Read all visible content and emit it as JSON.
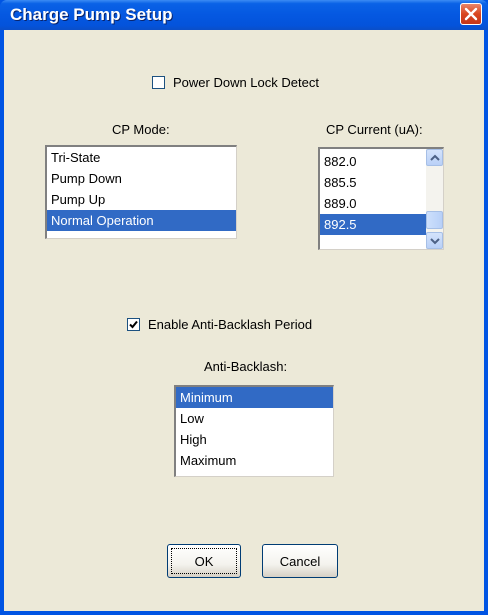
{
  "window": {
    "title": "Charge Pump Setup"
  },
  "power_down": {
    "label": "Power Down Lock Detect",
    "checked": false
  },
  "cp_mode": {
    "label": "CP Mode:",
    "items": [
      "Tri-State",
      "Pump Down",
      "Pump Up",
      "Normal Operation"
    ],
    "selected": "Normal Operation"
  },
  "cp_current": {
    "label": "CP Current (uA):",
    "items": [
      "882.0",
      "885.5",
      "889.0",
      "892.5"
    ],
    "selected": "892.5"
  },
  "anti_backlash_enable": {
    "label": "Enable Anti-Backlash Period",
    "checked": true
  },
  "anti_backlash": {
    "label": "Anti-Backlash:",
    "items": [
      "Minimum",
      "Low",
      "High",
      "Maximum"
    ],
    "selected": "Minimum"
  },
  "buttons": {
    "ok": "OK",
    "cancel": "Cancel"
  },
  "icons": {
    "close": "close-icon",
    "checkmark": "checkmark-icon",
    "scroll_up": "chevron-up-icon",
    "scroll_down": "chevron-down-icon"
  },
  "colors": {
    "title_bar": "#0558e1",
    "selection": "#316ac5",
    "dialog_bg": "#ece9d8",
    "close": "#d9461f"
  }
}
